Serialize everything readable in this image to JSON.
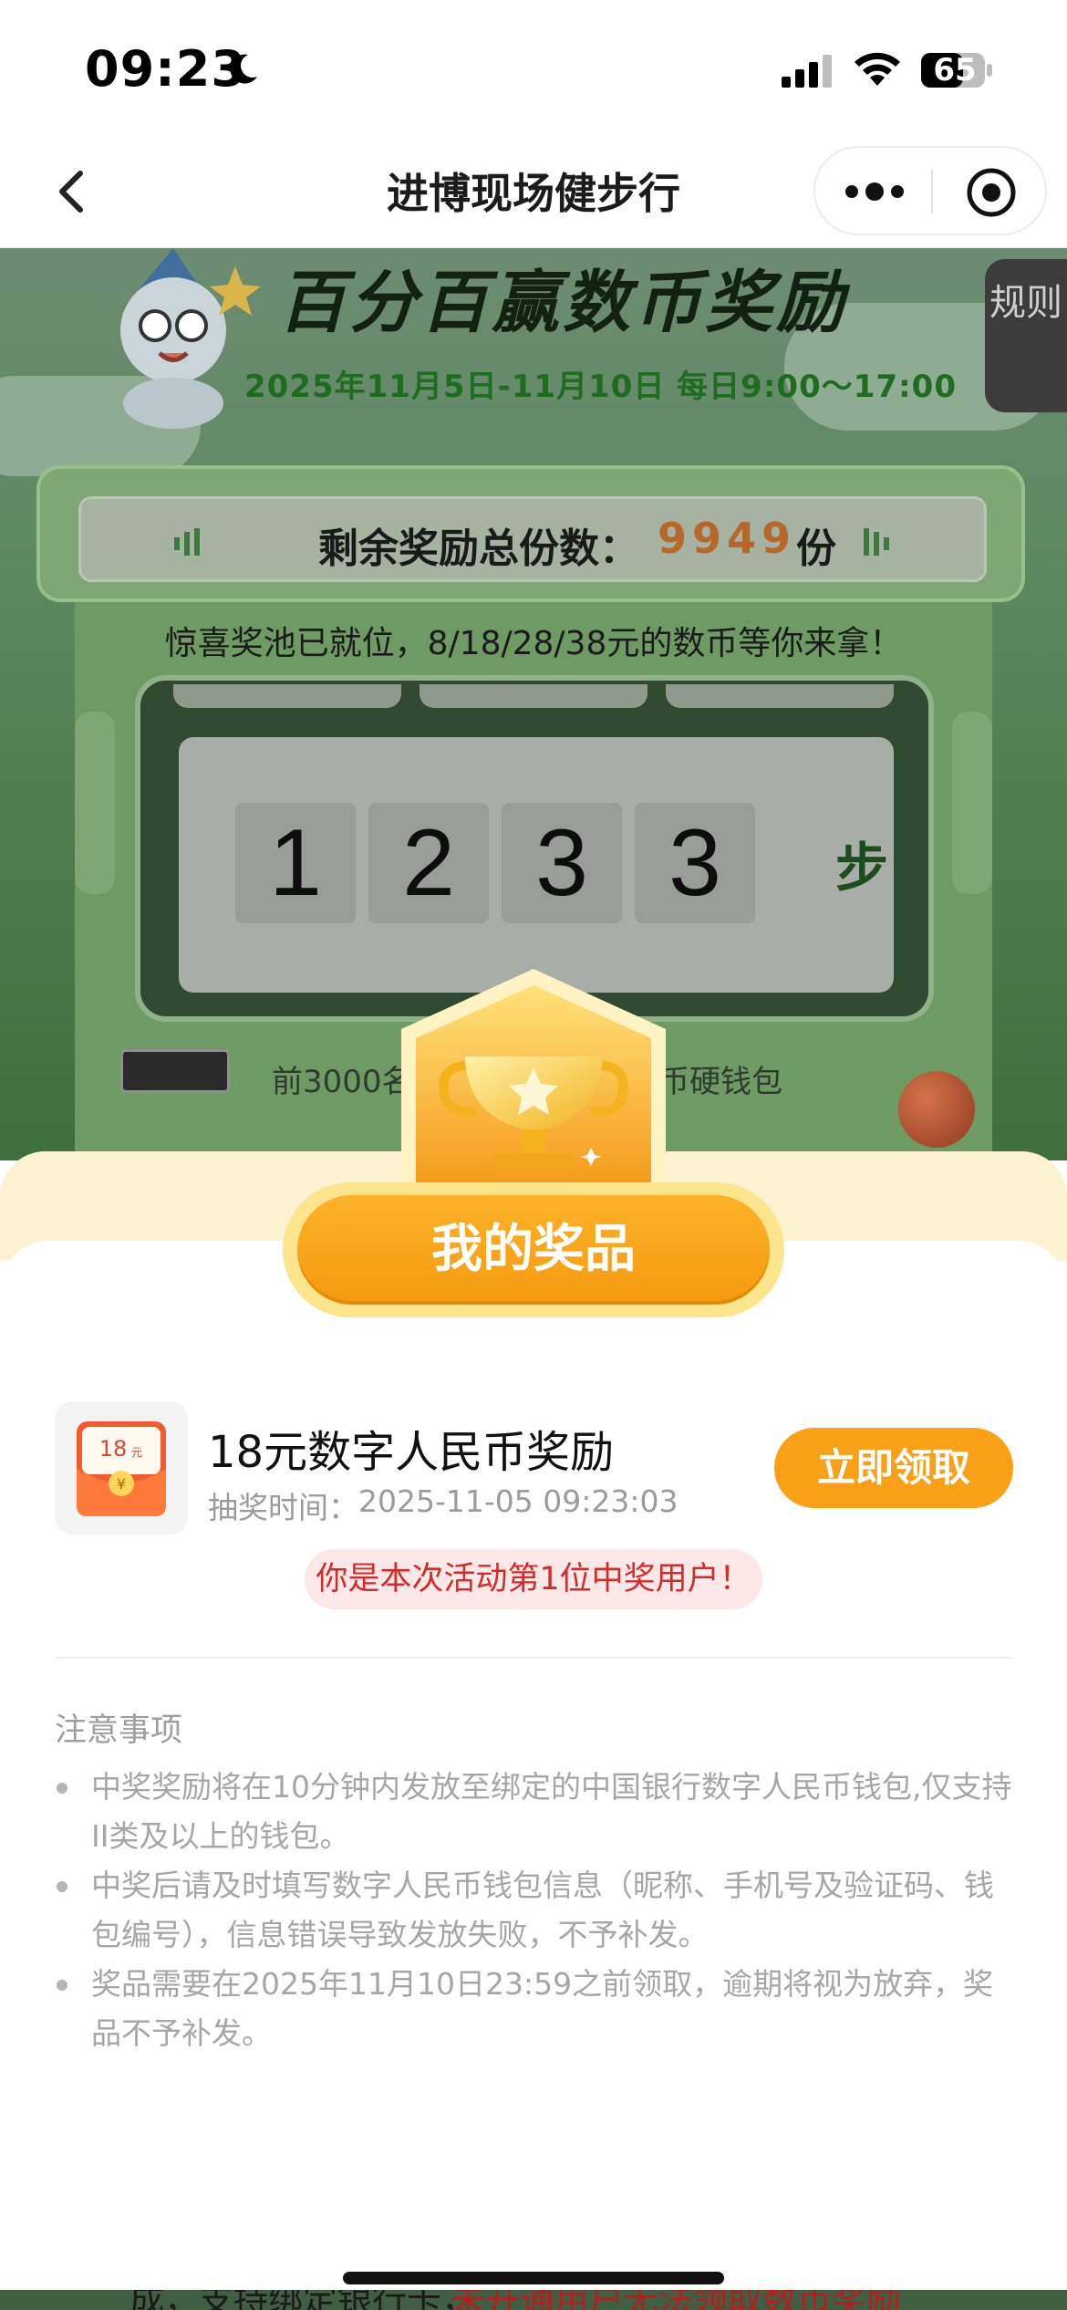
{
  "status_bar": {
    "time": "09:23",
    "battery": "65"
  },
  "nav": {
    "title": "进博现场健步行"
  },
  "activity": {
    "banner_title": "百分百赢数币奖励",
    "banner_date": "2025年11月5日-11月10日 每日9:00～17:00",
    "rules_label": "规则",
    "remaining_label": "剩余奖励总份数：",
    "remaining_value": "9949",
    "remaining_unit": "份",
    "pool_text": "惊喜奖池已就位，8/18/28/38元的数币等你来拿！",
    "steps_digits": [
      "1",
      "2",
      "3",
      "3"
    ],
    "steps_unit": "步",
    "bottom_text_left": "前3000名",
    "bottom_text_right": "币硬钱包"
  },
  "prize_sheet": {
    "my_prizes_label": "我的奖品",
    "prize_amount_label": "18",
    "prize_amount_unit": "元",
    "prize_name": "18元数字人民币奖励",
    "draw_time_label": "抽奖时间：",
    "draw_time": "2025-11-05 09:23:03",
    "claim_button": "立即领取",
    "winner_badge": "你是本次活动第1位中奖用户！",
    "notes_title": "注意事项",
    "notes": [
      "中奖奖励将在10分钟内发放至绑定的中国银行数字人民币钱包,仅支持II类及以上的钱包。",
      "中奖后请及时填写数字人民币钱包信息（昵称、手机号及验证码、钱包编号），信息错误导致发放失败，不予补发。",
      "奖品需要在2025年11月10日23:59之前领取，逾期将视为放弃，奖品不予补发。"
    ]
  },
  "bottom_strip": {
    "text_a": "成，支持绑定银行卡，",
    "text_b": "未开通用户无法领取数币奖励"
  },
  "colors": {
    "accent_orange": "#f8a116",
    "winner_red": "#d22b2b",
    "activity_green": "#5f8a62"
  }
}
